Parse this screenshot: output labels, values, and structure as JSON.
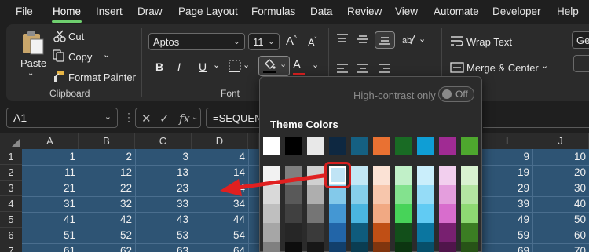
{
  "menu": {
    "items": [
      "File",
      "Home",
      "Insert",
      "Draw",
      "Page Layout",
      "Formulas",
      "Data",
      "Review",
      "View",
      "Automate",
      "Developer",
      "Help"
    ],
    "active": "Home"
  },
  "clipboard": {
    "paste_label": "Paste",
    "cut_label": "Cut",
    "copy_label": "Copy",
    "format_painter_label": "Format Painter",
    "group_label": "Clipboard"
  },
  "font": {
    "font_name": "Aptos",
    "font_size": "11",
    "bold": "B",
    "italic": "I",
    "underline": "U",
    "font_color_glyph": "A",
    "grow_glyph": "A",
    "shrink_glyph": "A",
    "group_label": "Font"
  },
  "alignment": {
    "wrap_text_label": "Wrap Text",
    "merge_center_label": "Merge & Center"
  },
  "number": {
    "format_value": "Ger"
  },
  "formula_bar": {
    "name_box": "A1",
    "fx_label": "fx",
    "formula": "=SEQUENC"
  },
  "grid": {
    "columns": [
      "A",
      "B",
      "C",
      "D",
      "I",
      "J"
    ],
    "rows": [
      "1",
      "2",
      "3",
      "4",
      "5",
      "6",
      "7"
    ],
    "cells_left": [
      [
        "1",
        "2",
        "3",
        "4"
      ],
      [
        "11",
        "12",
        "13",
        "14"
      ],
      [
        "21",
        "22",
        "23",
        "24"
      ],
      [
        "31",
        "32",
        "33",
        "34"
      ],
      [
        "41",
        "42",
        "43",
        "44"
      ],
      [
        "51",
        "52",
        "53",
        "54"
      ],
      [
        "61",
        "62",
        "63",
        "64"
      ]
    ],
    "cells_right": [
      [
        "9",
        "10"
      ],
      [
        "19",
        "20"
      ],
      [
        "29",
        "30"
      ],
      [
        "39",
        "40"
      ],
      [
        "49",
        "50"
      ],
      [
        "59",
        "60"
      ],
      [
        "69",
        "70"
      ]
    ]
  },
  "fill_panel": {
    "high_contrast_label": "High-contrast only",
    "toggle_state": "Off",
    "theme_colors_title": "Theme Colors",
    "top_row": [
      "#ffffff",
      "#000000",
      "#e8e8e8",
      "#0e2841",
      "#156082",
      "#e97132",
      "#196b24",
      "#0f9ed5",
      "#a02b93",
      "#4ea72e"
    ],
    "shade_columns": [
      [
        "#f2f2f2",
        "#d9d9d9",
        "#bfbfbf",
        "#a6a6a6",
        "#808080"
      ],
      [
        "#7f7f7f",
        "#595959",
        "#404040",
        "#262626",
        "#0d0d0d"
      ],
      [
        "#d0d0d0",
        "#aeaeae",
        "#757575",
        "#3a3a3a",
        "#171717"
      ],
      [
        "#c0e4f5",
        "#83c9ea",
        "#4497d3",
        "#2265a8",
        "#123f6b"
      ],
      [
        "#c2e7f5",
        "#86cfea",
        "#4ab5df",
        "#0f5b7c",
        "#0a3d52"
      ],
      [
        "#fbe2d5",
        "#f7c6ac",
        "#f1a983",
        "#c04f15",
        "#80350e"
      ],
      [
        "#c1f0c8",
        "#83e28e",
        "#47d359",
        "#124f1a",
        "#0c3511"
      ],
      [
        "#caeefb",
        "#95dcf7",
        "#61cbf3",
        "#0b76a0",
        "#074f6a"
      ],
      [
        "#f2cfee",
        "#e49edd",
        "#d86dcd",
        "#782070",
        "#50154b"
      ],
      [
        "#d9f2d0",
        "#b4e5a2",
        "#8ed973",
        "#3b7d23",
        "#275317"
      ]
    ],
    "selected_swatch": "#c0e4f5",
    "highlight_color": "#d62020"
  }
}
